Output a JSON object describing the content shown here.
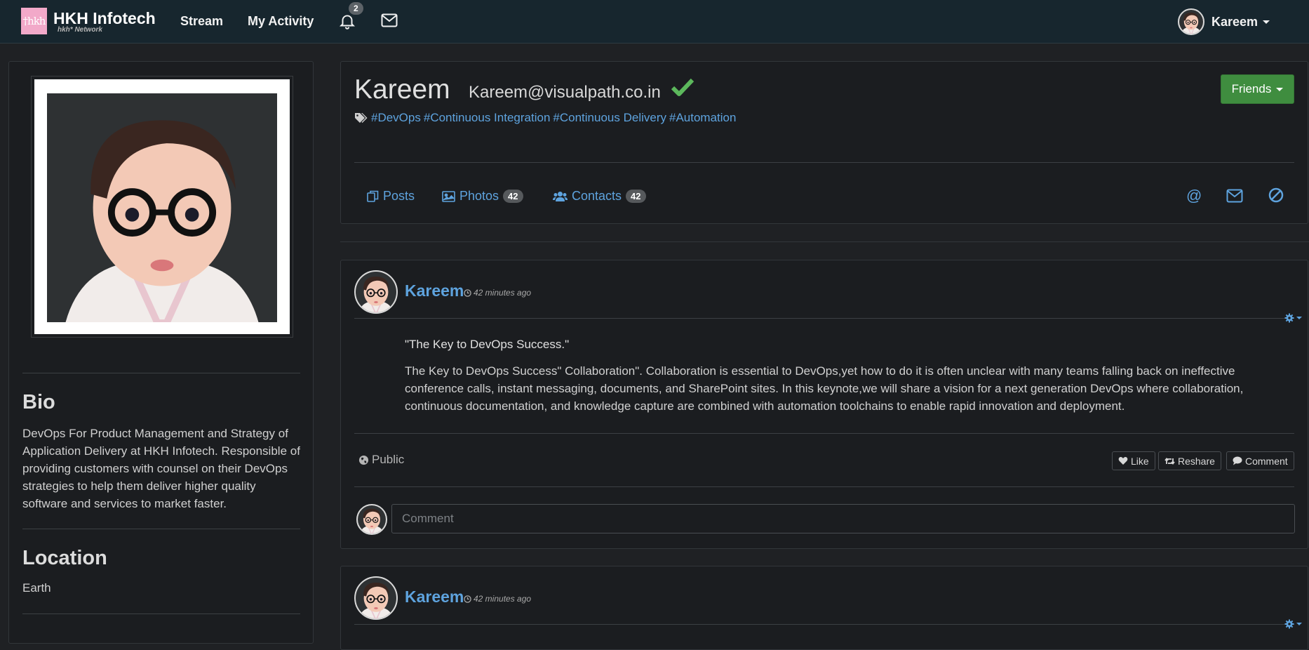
{
  "navbar": {
    "brand_logo": "†hkh",
    "brand_name": "HKH Infotech",
    "brand_sub": "hkh* Network",
    "stream_label": "Stream",
    "activity_label": "My Activity",
    "notification_count": "2",
    "user_name": "Kareem"
  },
  "sidebar": {
    "bio_title": "Bio",
    "bio_text": "DevOps For Product Management and Strategy of Application Delivery at HKH Infotech. Responsible of providing customers with counsel on their DevOps strategies to help them deliver higher quality software and services to market faster.",
    "location_title": "Location",
    "location_text": "Earth"
  },
  "profile": {
    "name": "Kareem",
    "email": "Kareem@visualpath.co.in",
    "tags": [
      "#DevOps",
      "#Continuous Integration",
      "#Continuous Delivery",
      "#Automation"
    ],
    "friends_button": "Friends",
    "tabs": [
      {
        "label": "Posts"
      },
      {
        "label": "Photos",
        "count": "42"
      },
      {
        "label": "Contacts",
        "count": "42"
      }
    ]
  },
  "posts": [
    {
      "author": "Kareem",
      "time": "42 minutes ago",
      "title": "\"The Key to DevOps Success.\"",
      "body": "The Key to DevOps Success\" Collaboration\". Collaboration is essential to DevOps,yet how to do it is often unclear with many teams falling back on ineffective conference calls, instant messaging, documents, and SharePoint sites. In this keynote,we will share a vision for a next generation DevOps where collaboration, continuous documentation, and knowledge capture are combined with automation toolchains to enable rapid innovation and deployment.",
      "visibility": "Public",
      "like_label": "Like",
      "reshare_label": "Reshare",
      "comment_label": "Comment",
      "comment_placeholder": "Comment"
    },
    {
      "author": "Kareem",
      "time": "42 minutes ago"
    }
  ],
  "colors": {
    "accent": "#5ea3de",
    "success": "#3f8d3f",
    "navbar": "#17262e",
    "background": "#1f2124"
  },
  "icons": [
    "bell-icon",
    "envelope-icon",
    "tags-icon",
    "check-icon",
    "posts-icon",
    "photos-icon",
    "contacts-icon",
    "mention-icon",
    "message-icon",
    "block-icon",
    "clock-icon",
    "gear-icon",
    "globe-icon",
    "heart-icon",
    "retweet-icon",
    "comment-icon"
  ]
}
